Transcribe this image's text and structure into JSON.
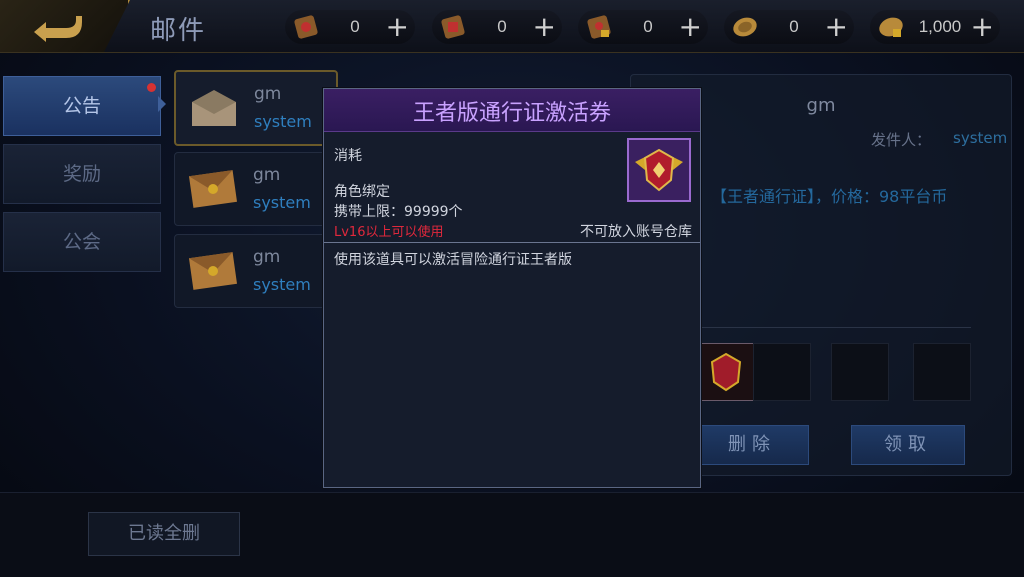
{
  "header": {
    "title": "邮件",
    "currencies": [
      {
        "icon": "scroll-ticket-icon",
        "value": "0"
      },
      {
        "icon": "scroll-ticket-icon",
        "value": "0"
      },
      {
        "icon": "locked-scroll-icon",
        "value": "0"
      },
      {
        "icon": "coin-icon",
        "value": "0"
      },
      {
        "icon": "locked-coin-icon",
        "value": "1,000"
      }
    ],
    "plus": "+"
  },
  "tabs": [
    {
      "label": "公告",
      "active": true,
      "has_dot": true
    },
    {
      "label": "奖励",
      "active": false
    },
    {
      "label": "公会",
      "active": false
    }
  ],
  "mails": [
    {
      "sender": "gm",
      "type": "system"
    },
    {
      "sender": "gm",
      "type": "system"
    },
    {
      "sender": "gm",
      "type": "system"
    }
  ],
  "detail": {
    "title": "gm",
    "from_label": "发件人：",
    "from_value": "system",
    "body": "【王者通行证】，价格：98平台币",
    "delete_label": "删除",
    "claim_label": "领取"
  },
  "read_all_delete": "已读全删",
  "popup": {
    "title": "王者版通行证激活券",
    "category": "消耗",
    "bind": "角色绑定",
    "limit": "携带上限：99999个",
    "requirement": "Lv16以上可以使用",
    "storage": "不可放入账号仓库",
    "description": "使用该道具可以激活冒险通行证王者版"
  },
  "colors": {
    "accent_purple": "#c9a2ff",
    "warning_red": "#e0283c",
    "link_blue": "#2f7fbf"
  }
}
